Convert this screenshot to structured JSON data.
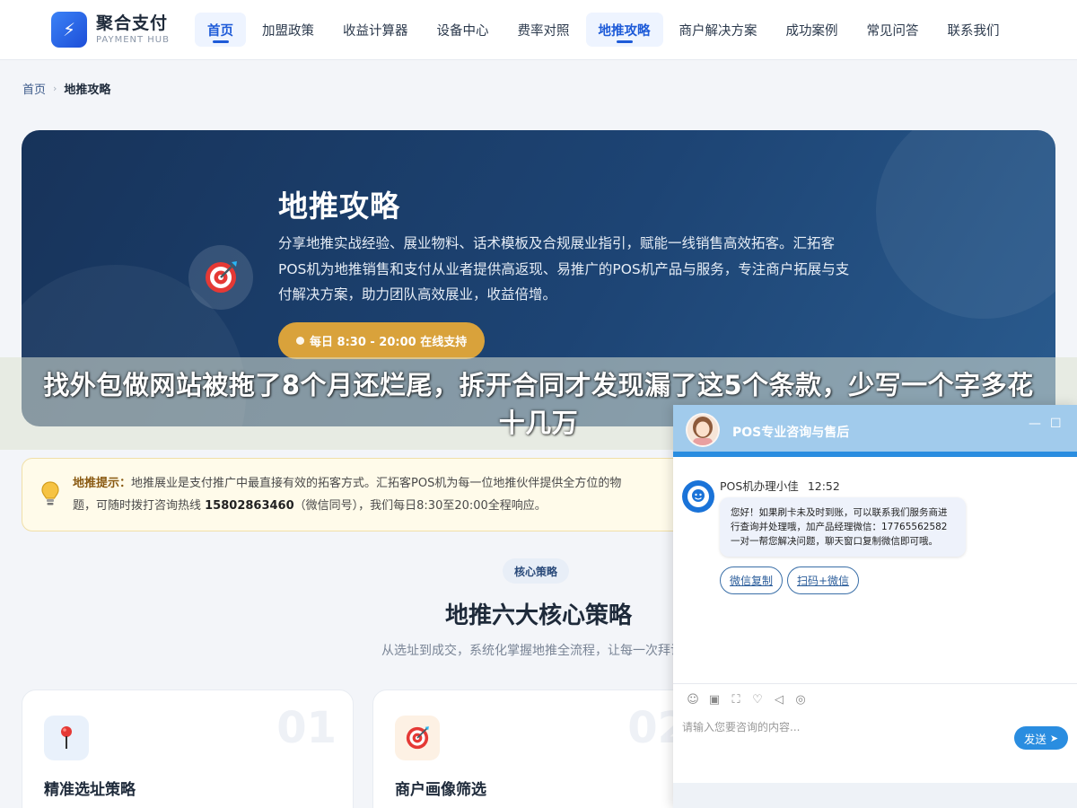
{
  "header": {
    "logo_name": "聚合支付",
    "logo_sub": "PAYMENT HUB",
    "nav": [
      "首页",
      "加盟政策",
      "收益计算器",
      "设备中心",
      "费率对照",
      "地推攻略",
      "商户解决方案",
      "成功案例",
      "常见问答",
      "联系我们"
    ]
  },
  "breadcrumb": {
    "home": "首页",
    "current": "地推攻略"
  },
  "hero": {
    "title": "地推攻略",
    "desc": "分享地推实战经验、展业物料、话术模板及合规展业指引，赋能一线销售高效拓客。汇拓客POS机为地推销售和支付从业者提供高返现、易推广的POS机产品与服务，专注商户拓展与支付解决方案，助力团队高效展业，收益倍增。",
    "cta": "每日 8:30 - 20:00 在线支持"
  },
  "overlay": {
    "text": "找外包做网站被拖了8个月还烂尾，拆开合同才发现漏了这5个条款，少写一个字多花十几万"
  },
  "tip": {
    "label": "地推提示：",
    "text_part1": "地推展业是支付推广中最直接有效的拓客方式。汇拓客POS机为每一位地推伙伴提供全方位的物",
    "text_part2": "题，可随时拨打咨询热线 ",
    "phone": "15802863460",
    "text_part3": "（微信同号），我们每日8:30至20:00全程响应。"
  },
  "section": {
    "tag": "核心策略",
    "title": "地推六大核心策略",
    "subtitle": "从选址到成交，系统化掌握地推全流程，让每一次拜访都"
  },
  "cards": [
    {
      "num": "01",
      "title": "精准选址策略",
      "icon": "pin-icon"
    },
    {
      "num": "02",
      "title": "商户画像筛选",
      "icon": "target-icon"
    }
  ],
  "chat": {
    "title": "POS专业咨询与售后",
    "agent_name": "POS机办理小佳",
    "time": "12:52",
    "message": "您好！如果刷卡未及时到账，可以联系我们服务商进行查询并处理哦，加产品经理微信：17765562582 一对一帮您解决问题，聊天窗口复制微信即可哦。",
    "quick_buttons": [
      "微信复制",
      "扫码+微信"
    ],
    "input_placeholder": "请输入您要咨询的内容...",
    "send_label": "发送"
  }
}
